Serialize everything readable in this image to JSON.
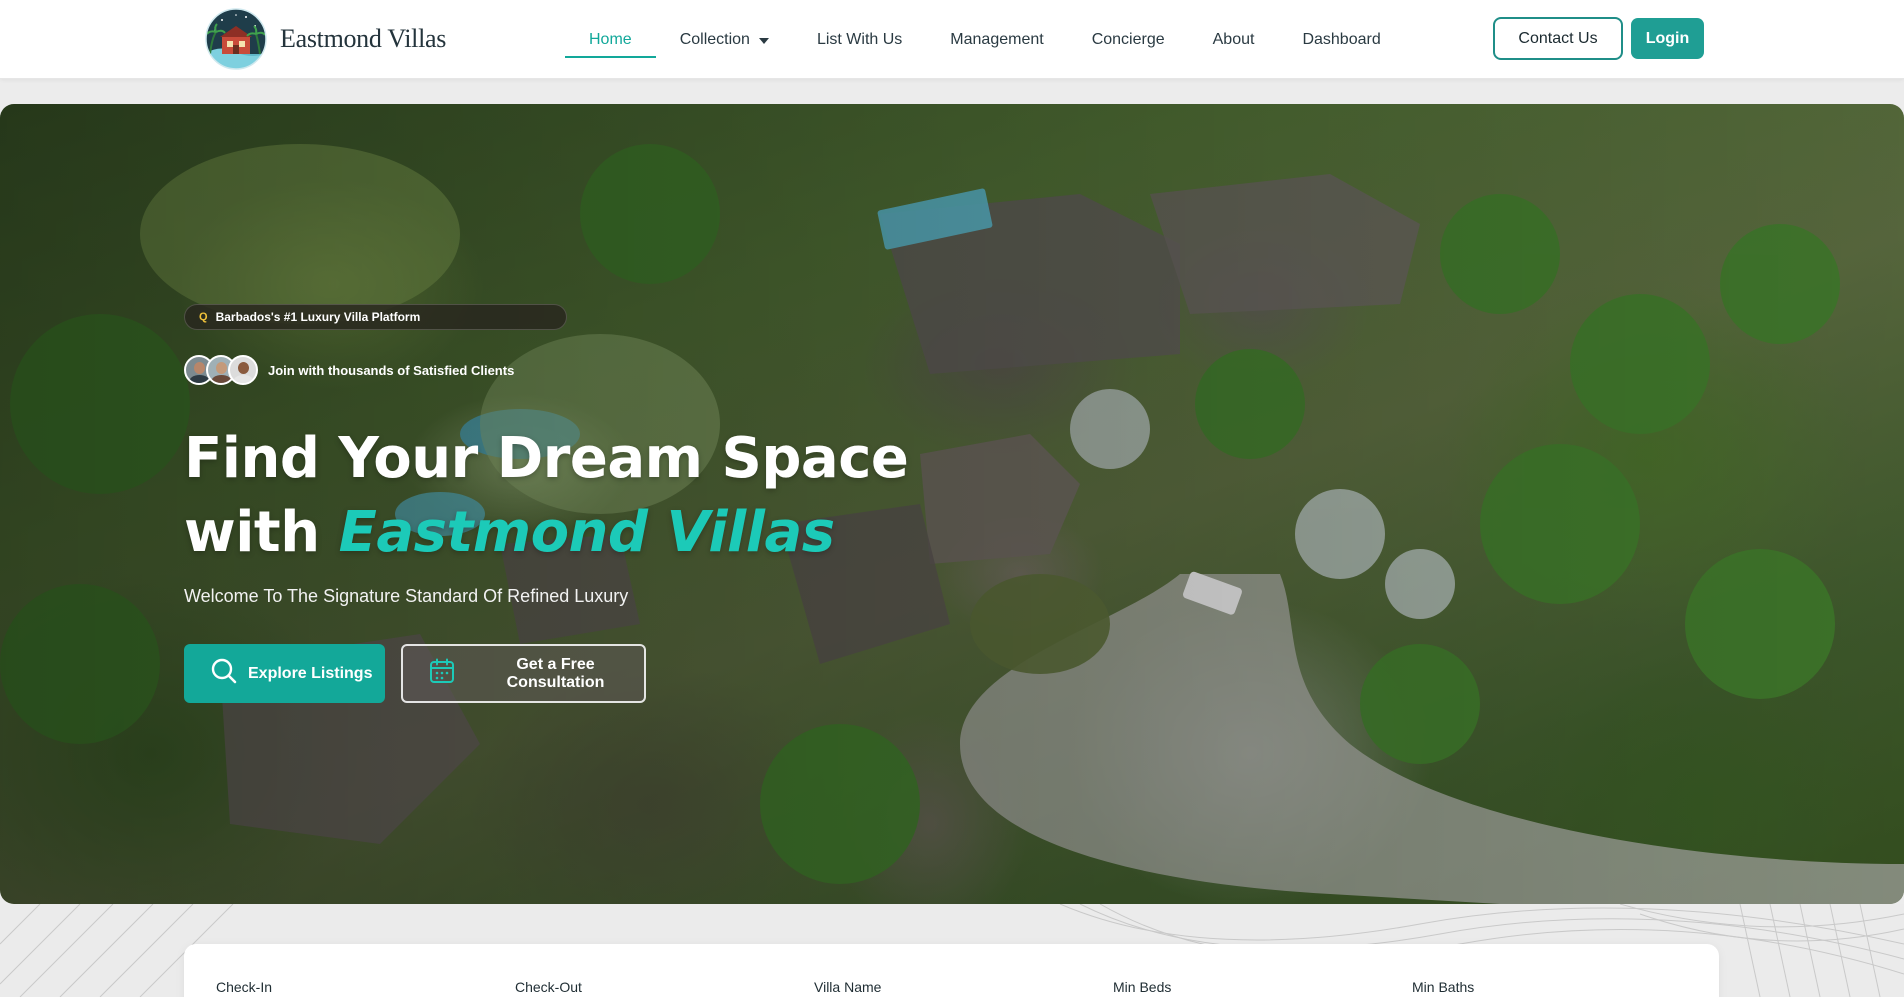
{
  "brand": {
    "name": "Eastmond Villas"
  },
  "nav": {
    "items": [
      {
        "label": "Home",
        "active": true
      },
      {
        "label": "Collection",
        "has_dropdown": true
      },
      {
        "label": "List With Us"
      },
      {
        "label": "Management"
      },
      {
        "label": "Concierge"
      },
      {
        "label": "About"
      },
      {
        "label": "Dashboard"
      }
    ],
    "contact_label": "Contact Us",
    "login_label": "Login"
  },
  "hero": {
    "badge_icon": "search-icon",
    "badge_text": "Barbados's #1 Luxury Villa Platform",
    "clients_text": "Join with thousands of Satisfied Clients",
    "title_line1": "Find Your Dream Space",
    "title_prefix": "with",
    "title_accent": "Eastmond Villas",
    "subtitle": "Welcome To The Signature Standard Of Refined Luxury",
    "explore_label": "Explore Listings",
    "consult_label": "Get a Free Consultation"
  },
  "search": {
    "fields": [
      "Check-In",
      "Check-Out",
      "Villa Name",
      "Min Beds",
      "Min Baths"
    ]
  },
  "colors": {
    "accent": "#13a899",
    "accent_text": "#1ccab8",
    "nav_active": "#12a89a",
    "login_bg": "#1f9e94"
  }
}
